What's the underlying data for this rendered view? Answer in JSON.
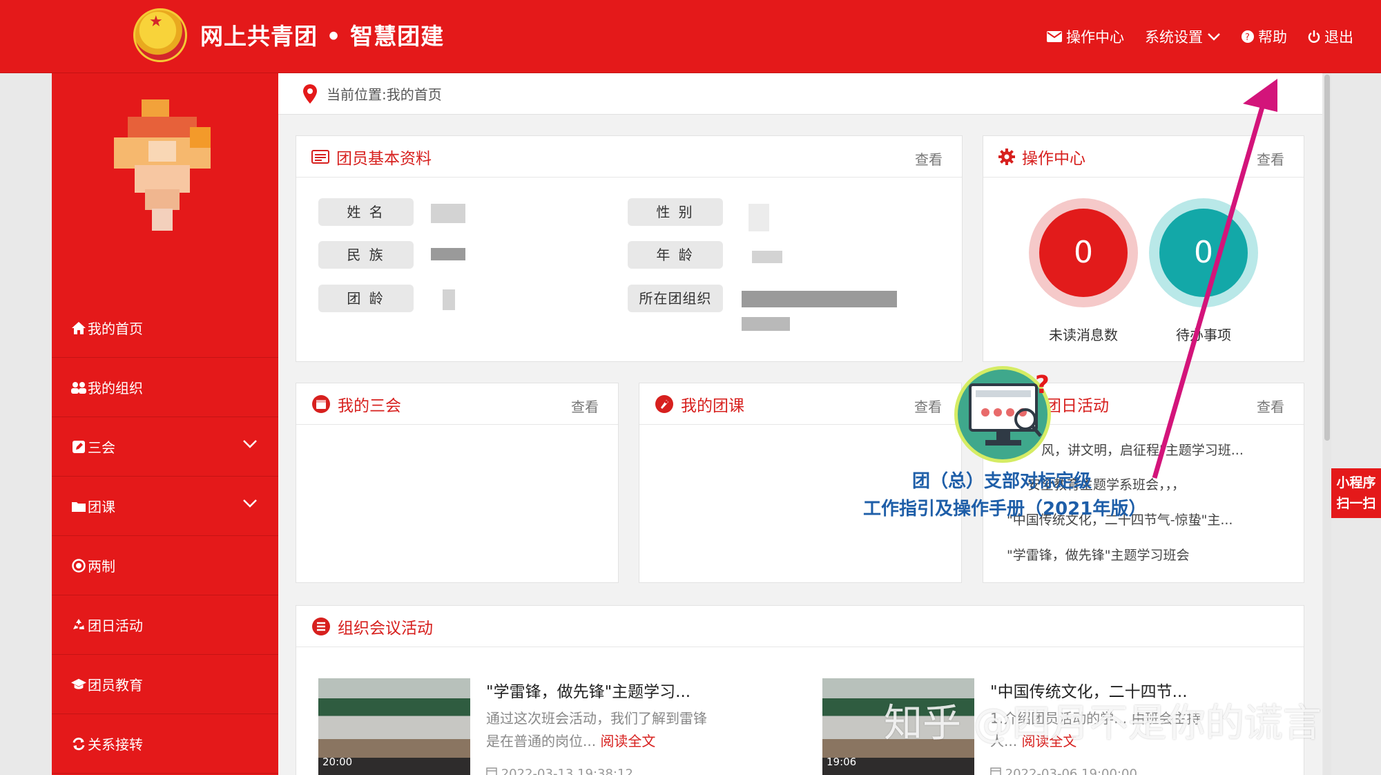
{
  "header": {
    "title": "网上共青团 • 智慧团建",
    "nav": [
      {
        "label": "操作中心",
        "icon": "envelope-icon"
      },
      {
        "label": "系统设置",
        "icon": "chevron-down-icon"
      },
      {
        "label": "帮助",
        "icon": "help-icon"
      },
      {
        "label": "退出",
        "icon": "power-icon"
      }
    ]
  },
  "sidebar": {
    "items": [
      {
        "label": "我的首页",
        "icon": "home-icon"
      },
      {
        "label": "我的组织",
        "icon": "users-icon"
      },
      {
        "label": "三会",
        "icon": "edit-icon",
        "expandable": true
      },
      {
        "label": "团课",
        "icon": "folder-icon",
        "expandable": true
      },
      {
        "label": "两制",
        "icon": "target-icon"
      },
      {
        "label": "团日活动",
        "icon": "recycle-icon"
      },
      {
        "label": "团员教育",
        "icon": "graduation-cap-icon"
      },
      {
        "label": "关系接转",
        "icon": "refresh-icon"
      }
    ]
  },
  "breadcrumb": {
    "text": "当前位置:我的首页"
  },
  "profile": {
    "title": "团员基本资料",
    "more": "查看",
    "labels": [
      "姓 名",
      "性 别",
      "民 族",
      "年 龄",
      "团 龄",
      "所在团组织"
    ]
  },
  "operation": {
    "title": "操作中心",
    "more": "查看",
    "unread_count": "0",
    "unread_label": "未读消息数",
    "todo_count": "0",
    "todo_label": "待办事项"
  },
  "sanhui": {
    "title": "我的三会",
    "more": "查看"
  },
  "tuanke": {
    "title": "我的团课",
    "more": "查看"
  },
  "tuanri": {
    "title": "团日活动",
    "more": "查看",
    "items": [
      "风，讲文明，启征程\"主题学习班...",
      "安全教育主题学系班会，，，",
      "\"中国传统文化，二十四节气-惊蛰\"主...",
      "\"学雷锋，做先锋\"主题学习班会"
    ]
  },
  "meetings": {
    "title": "组织会议活动",
    "cards": [
      {
        "title": "\"学雷锋，做先锋\"主题学习...",
        "desc": "通过这次班会活动，我们了解到雷锋是在普通的岗位...",
        "read": "阅读全文",
        "date": "2022-03-13 19:38:12",
        "thumb_time": "20:00"
      },
      {
        "title": "\"中国传统文化，二十四节...",
        "desc": "1.介绍团员活动的学... 由班会主持人...",
        "read": "阅读全文",
        "date": "2022-03-06 19:00:00",
        "thumb_time": "19:06"
      }
    ]
  },
  "overlay": {
    "line1": "团（总）支部对标定级",
    "line2": "工作指引及操作手册（2021年版）"
  },
  "mini_program": {
    "line1": "小程序",
    "line2": "扫一扫"
  },
  "watermark": "知乎 @四月不是你的谎言",
  "colors": {
    "brand_red": "#e4191a",
    "accent_teal": "#13a8a8",
    "overlay_blue": "#1e5ea8",
    "arrow": "#d3147a"
  }
}
